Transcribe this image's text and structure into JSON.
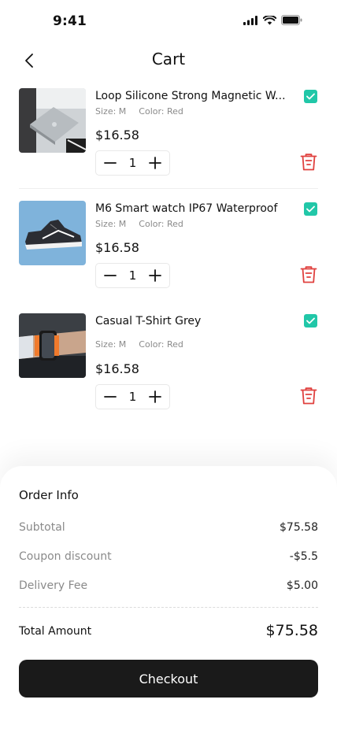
{
  "status_bar": {
    "time": "9:41"
  },
  "header": {
    "title": "Cart"
  },
  "cart_items": [
    {
      "title": "Loop Silicone Strong Magnetic W...",
      "size": "Size: M",
      "color": "Color: Red",
      "price": "$16.58",
      "quantity": "1",
      "checked": true
    },
    {
      "title": "M6 Smart watch IP67 Waterproof",
      "size": "Size: M",
      "color": "Color: Red",
      "price": "$16.58",
      "quantity": "1",
      "checked": true
    },
    {
      "title": "Casual T-Shirt Grey",
      "size": "Size: M",
      "color": "Color: Red",
      "price": "$16.58",
      "quantity": "1",
      "checked": true
    }
  ],
  "order_info": {
    "title": "Order Info",
    "subtotal_label": "Subtotal",
    "subtotal_value": "$75.58",
    "coupon_label": "Coupon discount",
    "coupon_value": "-$5.5",
    "delivery_label": "Delivery Fee",
    "delivery_value": "$5.00",
    "total_label": "Total Amount",
    "total_value": "$75.58"
  },
  "checkout": {
    "label": "Checkout"
  },
  "colors": {
    "accent": "#21c7a8",
    "danger": "#e0413f",
    "button": "#1a1a1a"
  }
}
